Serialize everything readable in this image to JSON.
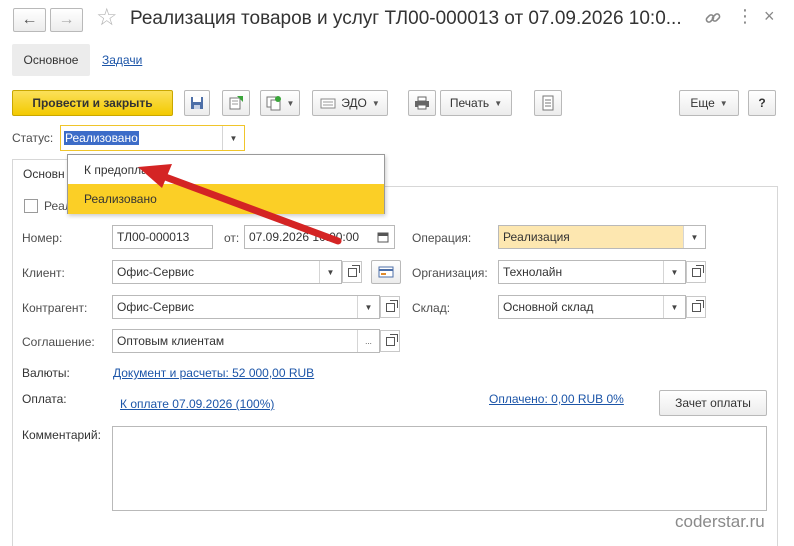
{
  "window": {
    "title": "Реализация товаров и услуг ТЛ00-000013 от 07.09.2026 10:0..."
  },
  "tabs": [
    {
      "label": "Основное"
    },
    {
      "label": "Задачи"
    }
  ],
  "toolbar": {
    "post_close": "Провести и закрыть",
    "edo": "ЭДО",
    "print": "Печать",
    "more": "Еще",
    "help": "?"
  },
  "status": {
    "label": "Статус:",
    "value": "Реализовано",
    "options": [
      "К предоплате",
      "Реализовано"
    ]
  },
  "inner_tab": {
    "label": "Основн"
  },
  "checkbox_label": "Реал",
  "form": {
    "number_label": "Номер:",
    "number_value": "ТЛ00-000013",
    "date_label": "от:",
    "date_value": "07.09.2026 10:00:00",
    "operation_label": "Операция:",
    "operation_value": "Реализация",
    "client_label": "Клиент:",
    "client_value": "Офис-Сервис",
    "org_label": "Организация:",
    "org_value": "Технолайн",
    "contractor_label": "Контрагент:",
    "contractor_value": "Офис-Сервис",
    "warehouse_label": "Склад:",
    "warehouse_value": "Основной склад",
    "agreement_label": "Соглашение:",
    "agreement_value": "Оптовым клиентам",
    "currency_label": "Валюты:",
    "currency_link": "Документ и расчеты: 52 000,00 RUB",
    "payment_label": "Оплата:",
    "payment_link": "К оплате 07.09.2026 (100%)",
    "paid_link": "Оплачено: 0,00 RUB 0%",
    "offset_button": "Зачет оплаты",
    "comment_label": "Комментарий:",
    "comment_value": ""
  },
  "watermark": "coderstar.ru",
  "colors": {
    "accent_yellow": "#f9d71c",
    "highlight": "#fbcf26",
    "operation_bg": "#fde7b0",
    "link": "#1c55a8",
    "arrow": "#d42424"
  }
}
